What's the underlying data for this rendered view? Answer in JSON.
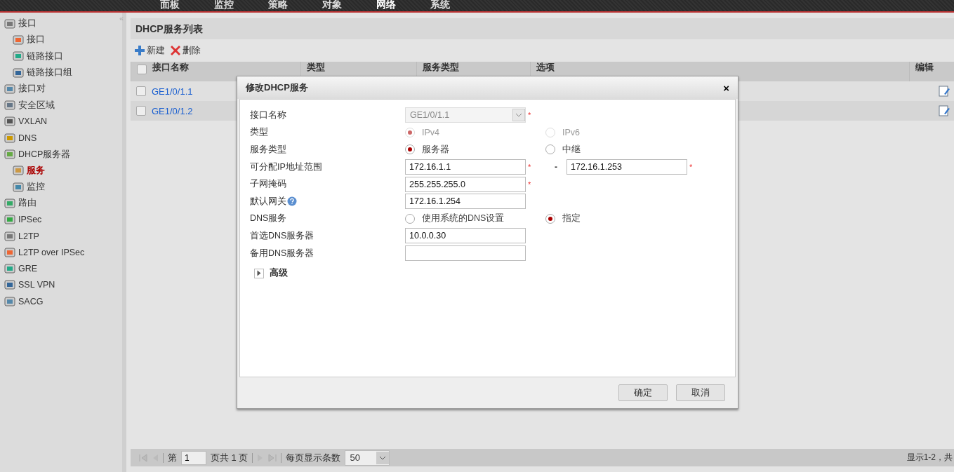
{
  "nav": [
    {
      "label": "面板",
      "selected": false
    },
    {
      "label": "监控",
      "selected": false
    },
    {
      "label": "策略",
      "selected": false
    },
    {
      "label": "对象",
      "selected": false
    },
    {
      "label": "网络",
      "selected": true
    },
    {
      "label": "系统",
      "selected": false
    }
  ],
  "sidebar": {
    "collapse": "«",
    "items": [
      {
        "label": "接口",
        "selected": false,
        "children": [
          {
            "label": "接口",
            "selected": false
          },
          {
            "label": "链路接口",
            "selected": false
          },
          {
            "label": "链路接口组",
            "selected": false
          }
        ]
      },
      {
        "label": "接口对",
        "selected": false
      },
      {
        "label": "安全区域",
        "selected": false
      },
      {
        "label": "VXLAN",
        "selected": false
      },
      {
        "label": "DNS",
        "selected": false
      },
      {
        "label": "DHCP服务器",
        "selected": false,
        "children": [
          {
            "label": "服务",
            "selected": true
          },
          {
            "label": "监控",
            "selected": false
          }
        ]
      },
      {
        "label": "路由",
        "selected": false
      },
      {
        "label": "IPSec",
        "selected": false
      },
      {
        "label": "L2TP",
        "selected": false
      },
      {
        "label": "L2TP over IPSec",
        "selected": false
      },
      {
        "label": "GRE",
        "selected": false
      },
      {
        "label": "SSL VPN",
        "selected": false
      },
      {
        "label": "SACG",
        "selected": false
      }
    ]
  },
  "panel": {
    "title": "DHCP服务列表",
    "toolbar": [
      {
        "label": "新建",
        "kind": "add"
      },
      {
        "label": "删除",
        "kind": "delete"
      }
    ],
    "table": {
      "all_checked": false,
      "columns": [
        "接口名称",
        "类型",
        "服务类型",
        "选项",
        "编辑"
      ],
      "rows": [
        {
          "name": "GE1/0/1.1",
          "checked": false
        },
        {
          "name": "GE1/0/1.2",
          "checked": false
        }
      ]
    },
    "pager": {
      "page_prefix": "第",
      "page": "1",
      "page_suffix": "页共 1 页",
      "per_page_label": "每页显示条数",
      "per_page": "50",
      "summary": "显示1-2，共"
    }
  },
  "dialog": {
    "title": "修改DHCP服务",
    "close": "×",
    "fields": [
      {
        "kind": "select",
        "label": "接口名称",
        "value": "GE1/0/1.1",
        "mark": "*",
        "disabled": true
      },
      {
        "kind": "radio",
        "label": "类型",
        "disabled": true,
        "options": [
          {
            "label": "IPv4",
            "selected": true
          },
          {
            "label": "IPv6",
            "selected": false
          }
        ]
      },
      {
        "kind": "radio",
        "label": "服务类型",
        "disabled": false,
        "options": [
          {
            "label": "服务器",
            "selected": true
          },
          {
            "label": "中继",
            "selected": false
          }
        ]
      },
      {
        "kind": "range",
        "label": "可分配IP地址范围",
        "from": "172.16.1.1",
        "separator": "-",
        "to": "172.16.1.253",
        "mark": "*"
      },
      {
        "kind": "text",
        "label": "子网掩码",
        "value": "255.255.255.0",
        "mark": "*"
      },
      {
        "kind": "text",
        "label": "默认网关",
        "value": "172.16.1.254",
        "help": true
      },
      {
        "kind": "radio",
        "label": "DNS服务",
        "disabled": false,
        "options": [
          {
            "label": "使用系统的DNS设置",
            "selected": false
          },
          {
            "label": "指定",
            "selected": true
          }
        ]
      },
      {
        "kind": "text",
        "label": "首选DNS服务器",
        "value": "10.0.0.30"
      },
      {
        "kind": "text",
        "label": "备用DNS服务器"
      }
    ],
    "advanced": {
      "label": "高级",
      "expanded": false
    },
    "buttons": [
      "确定",
      "取消"
    ]
  }
}
